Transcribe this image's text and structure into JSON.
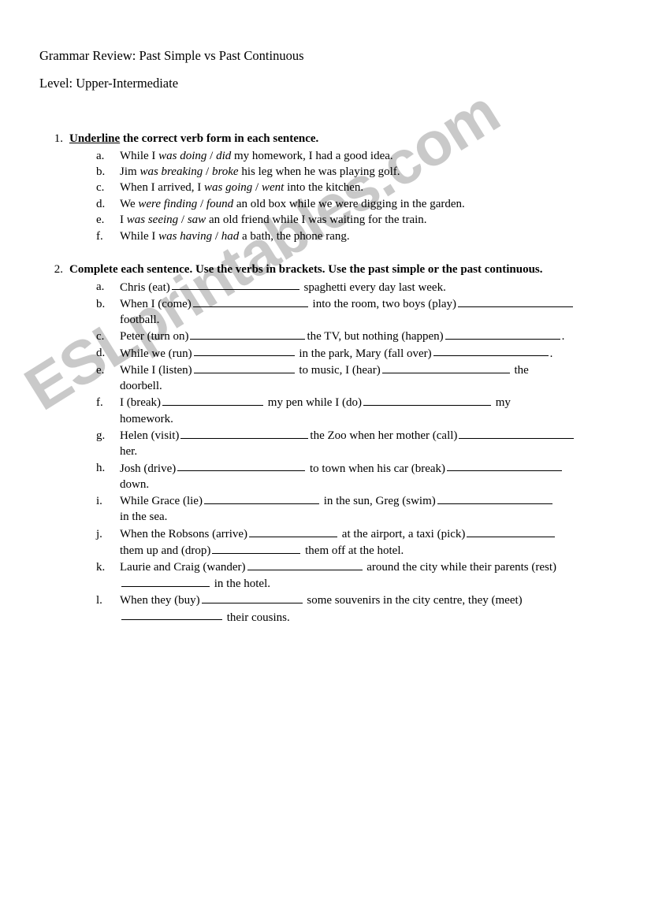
{
  "document": {
    "title": "Grammar Review: Past Simple vs Past Continuous",
    "level": "Level: Upper-Intermediate"
  },
  "watermark": {
    "text": "ESLprintables.com",
    "color": "#c9c9c9"
  },
  "exercises": [
    {
      "number": "1.",
      "instruction_underlined": "Underline",
      "instruction_rest": " the correct verb form in each sentence.",
      "items": [
        {
          "letter": "a.",
          "pre": "While I ",
          "opt1": "was doing",
          "sep": " / ",
          "opt2": "did",
          "post": " my homework, I had a good idea."
        },
        {
          "letter": "b.",
          "pre": "Jim ",
          "opt1": "was breaking",
          "sep": " / ",
          "opt2": "broke",
          "post": " his leg when he was playing golf."
        },
        {
          "letter": "c.",
          "pre": "When I arrived, I ",
          "opt1": "was going",
          "sep": " / ",
          "opt2": "went",
          "post": " into the kitchen."
        },
        {
          "letter": "d.",
          "pre": "We ",
          "opt1": "were finding",
          "sep": " / ",
          "opt2": "found",
          "post": " an old box while we were digging in the garden."
        },
        {
          "letter": "e.",
          "pre": "I ",
          "opt1": "was seeing",
          "sep": " / ",
          "opt2": "saw",
          "post": " an old friend while I was waiting for the train."
        },
        {
          "letter": "f.",
          "pre": "While I ",
          "opt1": "was having",
          "sep": " / ",
          "opt2": "had",
          "post": " a bath, the phone rang."
        }
      ]
    },
    {
      "number": "2.",
      "instruction_underlined": "",
      "instruction_rest": "Complete each sentence. Use the verbs in brackets. Use the past simple or the past continuous.",
      "items": [
        {
          "letter": "a.",
          "seg1": "Chris (eat)",
          "seg2": " spaghetti every day last week.",
          "seg3": "",
          "seg4": ""
        },
        {
          "letter": "b.",
          "seg1": "When I (come)",
          "seg2": " into the room, two boys (play)",
          "seg3": "",
          "seg4": "football."
        },
        {
          "letter": "c.",
          "seg1": "Peter (turn on)",
          "seg2": "the TV, but nothing (happen)",
          "seg3": ".",
          "seg4": ""
        },
        {
          "letter": "d.",
          "seg1": "While we (run)",
          "seg2": " in the park, Mary (fall over)",
          "seg3": ".",
          "seg4": ""
        },
        {
          "letter": "e.",
          "seg1": " While I (listen)",
          "seg2": " to music, I (hear)",
          "seg3": " the",
          "seg4": "doorbell."
        },
        {
          "letter": "f.",
          "seg1": "I (break)",
          "seg2": " my pen while I (do)",
          "seg3": " my",
          "seg4": "homework."
        },
        {
          "letter": "g.",
          "seg1": "Helen (visit)",
          "seg2": "the Zoo when her mother (call)",
          "seg3": "",
          "seg4": "her."
        },
        {
          "letter": "h.",
          "seg1": "Josh (drive)",
          "seg2": " to town when his car (break)",
          "seg3": "",
          "seg4": "down."
        },
        {
          "letter": "i.",
          "seg1": "While Grace (lie)",
          "seg2": " in the sun, Greg (swim)",
          "seg3": "",
          "seg4": "in the sea."
        },
        {
          "letter": "j.",
          "seg1": "When the Robsons (arrive)",
          "seg2": " at the airport, a taxi (pick)",
          "seg3": "",
          "seg4": "them up and (drop)",
          "seg5": " them off at the hotel."
        },
        {
          "letter": "k.",
          "seg1": "Laurie and Craig (wander)",
          "seg2": " around the city while their parents (rest)",
          "seg3": "",
          "seg4": "",
          "seg5": " in the hotel."
        },
        {
          "letter": "l.",
          "seg1": "When they (buy)",
          "seg2": " some souvenirs in the city centre, they (meet)",
          "seg3": "",
          "seg4": "",
          "seg5": " their cousins."
        }
      ]
    }
  ]
}
